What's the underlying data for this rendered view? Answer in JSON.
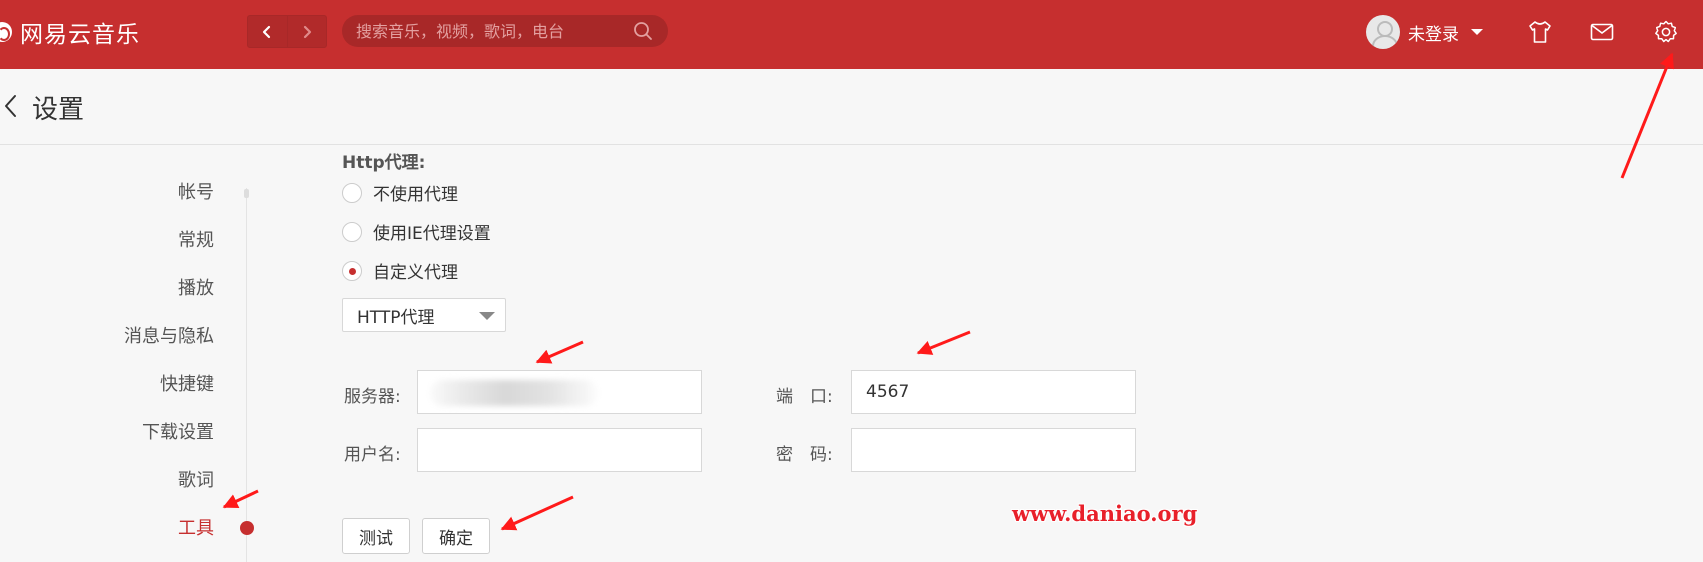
{
  "app": {
    "name": "网易云音乐",
    "search_placeholder": "搜索音乐，视频，歌词，电台",
    "user_label": "未登录"
  },
  "page": {
    "title": "设置"
  },
  "sidebar": {
    "items": [
      {
        "label": "帐号"
      },
      {
        "label": "常规"
      },
      {
        "label": "播放"
      },
      {
        "label": "消息与隐私"
      },
      {
        "label": "快捷键"
      },
      {
        "label": "下载设置"
      },
      {
        "label": "歌词"
      },
      {
        "label": "工具",
        "active": true
      }
    ]
  },
  "proxy": {
    "section_title": "Http代理:",
    "options": [
      {
        "label": "不使用代理",
        "checked": false
      },
      {
        "label": "使用IE代理设置",
        "checked": false
      },
      {
        "label": "自定义代理",
        "checked": true
      }
    ],
    "type_selected": "HTTP代理",
    "server_label": "服务器:",
    "server_value": "",
    "port_label": "端　口:",
    "port_value": "4567",
    "username_label": "用户名:",
    "username_value": "",
    "password_label": "密　码:",
    "password_value": "",
    "test_button": "测试",
    "ok_button": "确定"
  },
  "watermark": "www.daniao.org",
  "colors": {
    "brand": "#c62f2f",
    "annotation_arrow": "#ff1a1a"
  }
}
